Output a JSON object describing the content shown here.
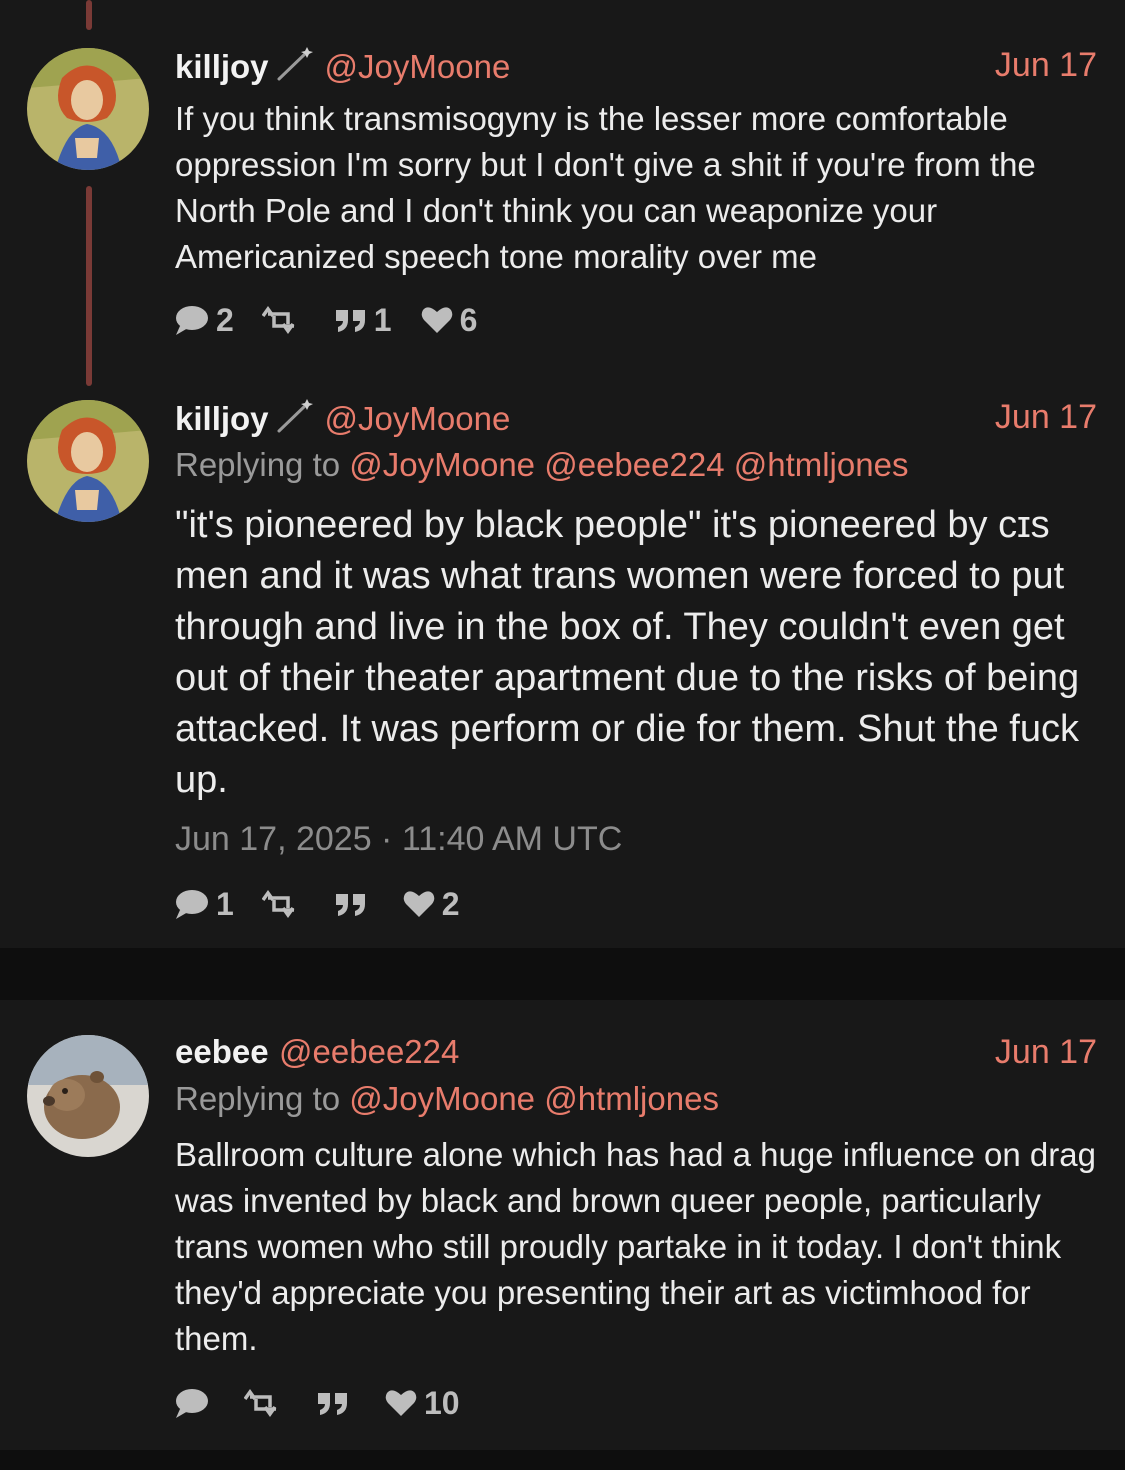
{
  "posts": [
    {
      "display_name": "killjoy",
      "handle": "@JoyMoone",
      "date": "Jun 17",
      "text": "If you think transmisogyny is the lesser more comfortable oppression I'm sorry but I don't give a shit if you're from the North Pole and I don't think you can weaponize your Americanized speech tone morality over me",
      "actions": {
        "replies": "2",
        "reposts": "",
        "quotes": "1",
        "likes": "6"
      }
    },
    {
      "display_name": "killjoy",
      "handle": "@JoyMoone",
      "date": "Jun 17",
      "replying_prefix": "Replying to",
      "replying_to": [
        "@JoyMoone",
        "@eebee224",
        "@htmljones"
      ],
      "text": "\"it's pioneered by black people\" it's pioneered by cɪs men and it was what trans women were forced to put through and live in the box of. They couldn't even get out of their theater apartment due to the risks of being attacked. It was perform or die for them. Shut the fuck up.",
      "timestamp": "Jun 17, 2025 · 11:40 AM UTC",
      "actions": {
        "replies": "1",
        "reposts": "",
        "quotes": "",
        "likes": "2"
      }
    },
    {
      "display_name": "eebee",
      "handle": "@eebee224",
      "date": "Jun 17",
      "replying_prefix": "Replying to",
      "replying_to": [
        "@JoyMoone",
        "@htmljones"
      ],
      "text": "Ballroom culture alone which has had a huge influence on drag was invented by black and brown queer people, particularly trans women who still proudly partake in it today. I don't think they'd appreciate you presenting their art as victimhood for them.",
      "actions": {
        "replies": "",
        "reposts": "",
        "quotes": "",
        "likes": "10"
      }
    }
  ],
  "icons": {
    "reply": "speech-bubble-icon",
    "repost": "retweet-arrows-icon",
    "quote": "quote-marks-icon",
    "like": "heart-icon",
    "badge": "magic-wand-icon"
  },
  "colors": {
    "background": "#0e0e0e",
    "panel": "#181818",
    "accent": "#e87c6c",
    "thread_line": "#7a3a36",
    "muted": "#9a9a9a"
  }
}
